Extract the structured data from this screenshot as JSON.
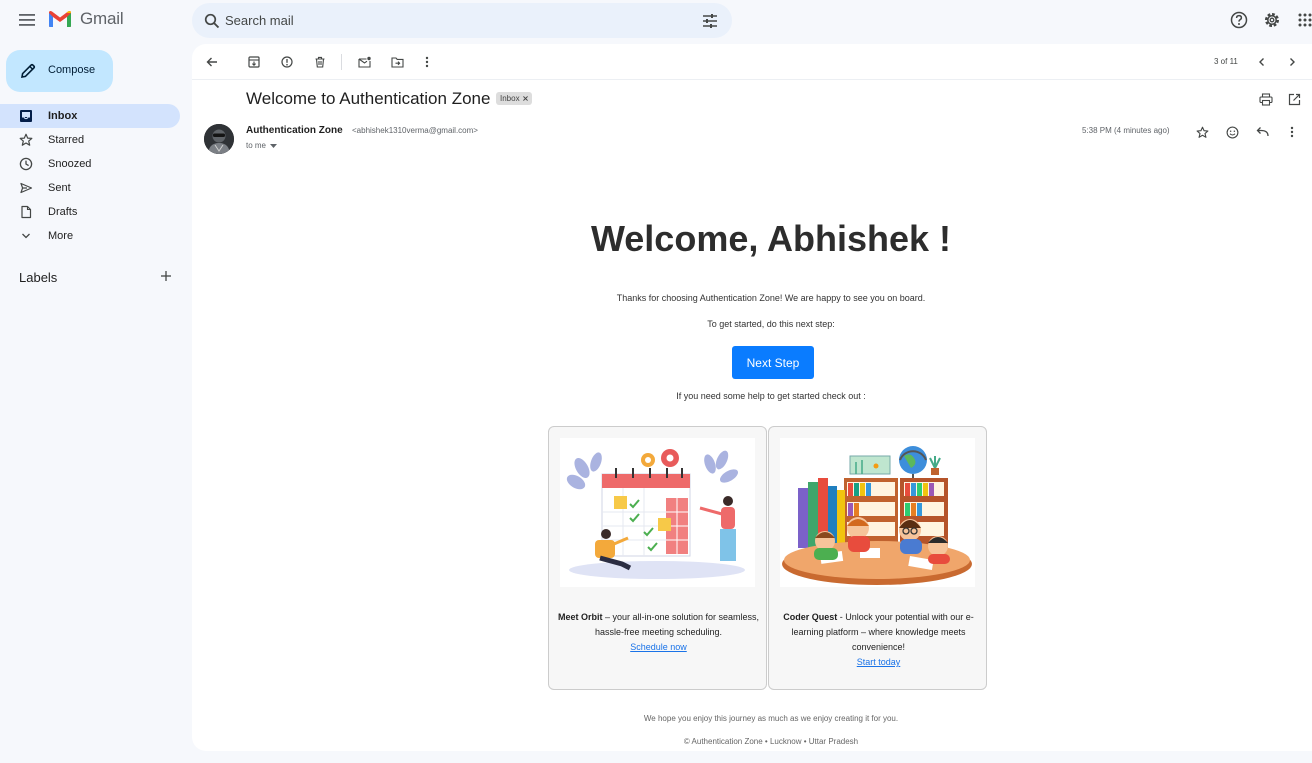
{
  "app": {
    "name": "Gmail"
  },
  "search": {
    "placeholder": "Search mail"
  },
  "sidebar": {
    "compose_label": "Compose",
    "items": [
      {
        "label": "Inbox",
        "icon": "inbox-icon",
        "active": true
      },
      {
        "label": "Starred",
        "icon": "star-icon"
      },
      {
        "label": "Snoozed",
        "icon": "clock-icon"
      },
      {
        "label": "Sent",
        "icon": "send-icon"
      },
      {
        "label": "Drafts",
        "icon": "draft-icon"
      },
      {
        "label": "More",
        "icon": "chevron-down-icon"
      }
    ],
    "labels_heading": "Labels"
  },
  "toolbar": {
    "pager": "3 of 11"
  },
  "email": {
    "subject": "Welcome to Authentication Zone",
    "badge": "Inbox",
    "sender_name": "Authentication Zone",
    "sender_email": "<abhishek1310verma@gmail.com>",
    "recipient": "to me",
    "time": "5:38 PM (4 minutes ago)"
  },
  "content": {
    "heading": "Welcome, Abhishek !",
    "intro": "Thanks for choosing Authentication Zone! We are happy to see you on board.",
    "prompt": "To get started, do this next step:",
    "button": "Next Step",
    "help": "If you need some help to get started check out :",
    "cards": [
      {
        "title": "Meet Orbit",
        "text": " – your all-in-one solution for seamless, hassle-free meeting scheduling.",
        "link": "Schedule now"
      },
      {
        "title": "Coder Quest",
        "text": " - Unlock your potential with our e-learning platform – where knowledge meets convenience!",
        "link": "Start today"
      }
    ],
    "footer_line1": "We hope you enjoy this journey as much as we enjoy creating it for you.",
    "footer_line2": "© Authentication Zone • Lucknow • Uttar Pradesh"
  },
  "colors": {
    "accent": "#0a7cff",
    "compose": "#c2e7ff",
    "active_nav": "#d3e3fd",
    "link": "#1a73e8"
  }
}
